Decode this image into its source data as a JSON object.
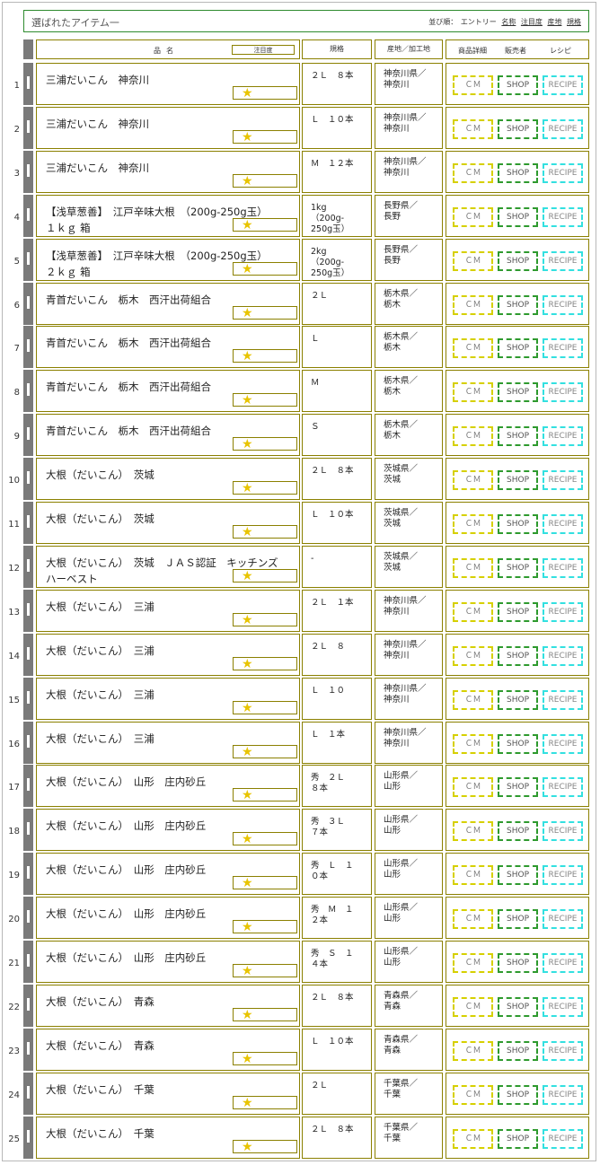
{
  "title": "選ばれたアイテム一",
  "sort": {
    "label": "並び順：",
    "entry": "エントリー",
    "name": "名称",
    "attention": "注目度",
    "origin": "産地",
    "spec": "規格"
  },
  "header": {
    "name": "品名",
    "attention": "注目度",
    "spec": "規格",
    "origin": "産地／加工地",
    "detail": "商品詳細",
    "seller": "販売者",
    "recipe": "レシピ"
  },
  "buttons": {
    "cm": "ＣＭ",
    "shop": "SHOP",
    "recipe": "RECIPE"
  },
  "star_glyph": "★",
  "rows": [
    {
      "num": "1",
      "name": "三浦だいこん　神奈川",
      "spec": "２Ｌ　８本",
      "origin": "神奈川県／\n神奈川"
    },
    {
      "num": "2",
      "name": "三浦だいこん　神奈川",
      "spec": "Ｌ　１０本",
      "origin": "神奈川県／\n神奈川"
    },
    {
      "num": "3",
      "name": "三浦だいこん　神奈川",
      "spec": "Ｍ　１２本",
      "origin": "神奈川県／\n神奈川"
    },
    {
      "num": "4",
      "name": "【浅草葱善】　江戸辛味大根　（200g-250g玉）\n１ｋｇ 箱",
      "spec": "1kg\n（200g-\n250g玉）",
      "origin": "長野県／\n長野"
    },
    {
      "num": "5",
      "name": "【浅草葱善】　江戸辛味大根　（200g-250g玉）\n２ｋｇ 箱",
      "spec": "2kg\n（200g-\n250g玉）",
      "origin": "長野県／\n長野"
    },
    {
      "num": "6",
      "name": "青首だいこん　栃木　西汗出荷組合",
      "spec": "２Ｌ",
      "origin": "栃木県／\n栃木"
    },
    {
      "num": "7",
      "name": "青首だいこん　栃木　西汗出荷組合",
      "spec": "Ｌ",
      "origin": "栃木県／\n栃木"
    },
    {
      "num": "8",
      "name": "青首だいこん　栃木　西汗出荷組合",
      "spec": "Ｍ",
      "origin": "栃木県／\n栃木"
    },
    {
      "num": "9",
      "name": "青首だいこん　栃木　西汗出荷組合",
      "spec": "Ｓ",
      "origin": "栃木県／\n栃木"
    },
    {
      "num": "10",
      "name": "大根（だいこん）　茨城",
      "spec": "２Ｌ　８本",
      "origin": "茨城県／\n茨城"
    },
    {
      "num": "11",
      "name": "大根（だいこん）　茨城",
      "spec": "Ｌ　１０本",
      "origin": "茨城県／\n茨城"
    },
    {
      "num": "12",
      "name": "大根（だいこん）　茨城　ＪＡＳ認証　キッチンズハーベスト",
      "spec": "-",
      "origin": "茨城県／\n茨城"
    },
    {
      "num": "13",
      "name": "大根（だいこん）　三浦",
      "spec": "２Ｌ　１本",
      "origin": "神奈川県／\n神奈川"
    },
    {
      "num": "14",
      "name": "大根（だいこん）　三浦",
      "spec": "２Ｌ　８",
      "origin": "神奈川県／\n神奈川"
    },
    {
      "num": "15",
      "name": "大根（だいこん）　三浦",
      "spec": "Ｌ　１０",
      "origin": "神奈川県／\n神奈川"
    },
    {
      "num": "16",
      "name": "大根（だいこん）　三浦",
      "spec": "Ｌ　１本",
      "origin": "神奈川県／\n神奈川"
    },
    {
      "num": "17",
      "name": "大根（だいこん）　山形　庄内砂丘",
      "spec": "秀　２Ｌ\n８本",
      "origin": "山形県／\n山形"
    },
    {
      "num": "18",
      "name": "大根（だいこん）　山形　庄内砂丘",
      "spec": "秀　３Ｌ\n７本",
      "origin": "山形県／\n山形"
    },
    {
      "num": "19",
      "name": "大根（だいこん）　山形　庄内砂丘",
      "spec": "秀　Ｌ　１\n０本",
      "origin": "山形県／\n山形"
    },
    {
      "num": "20",
      "name": "大根（だいこん）　山形　庄内砂丘",
      "spec": "秀　Ｍ　１\n２本",
      "origin": "山形県／\n山形"
    },
    {
      "num": "21",
      "name": "大根（だいこん）　山形　庄内砂丘",
      "spec": "秀　Ｓ　１\n４本",
      "origin": "山形県／\n山形"
    },
    {
      "num": "22",
      "name": "大根（だいこん）　青森",
      "spec": "２Ｌ　８本",
      "origin": "青森県／\n青森"
    },
    {
      "num": "23",
      "name": "大根（だいこん）　青森",
      "spec": "Ｌ　１０本",
      "origin": "青森県／\n青森"
    },
    {
      "num": "24",
      "name": "大根（だいこん）　千葉",
      "spec": "２Ｌ",
      "origin": "千葉県／\n千葉"
    },
    {
      "num": "25",
      "name": "大根（だいこん）　千葉",
      "spec": "２Ｌ　８本",
      "origin": "千葉県／\n千葉"
    }
  ]
}
